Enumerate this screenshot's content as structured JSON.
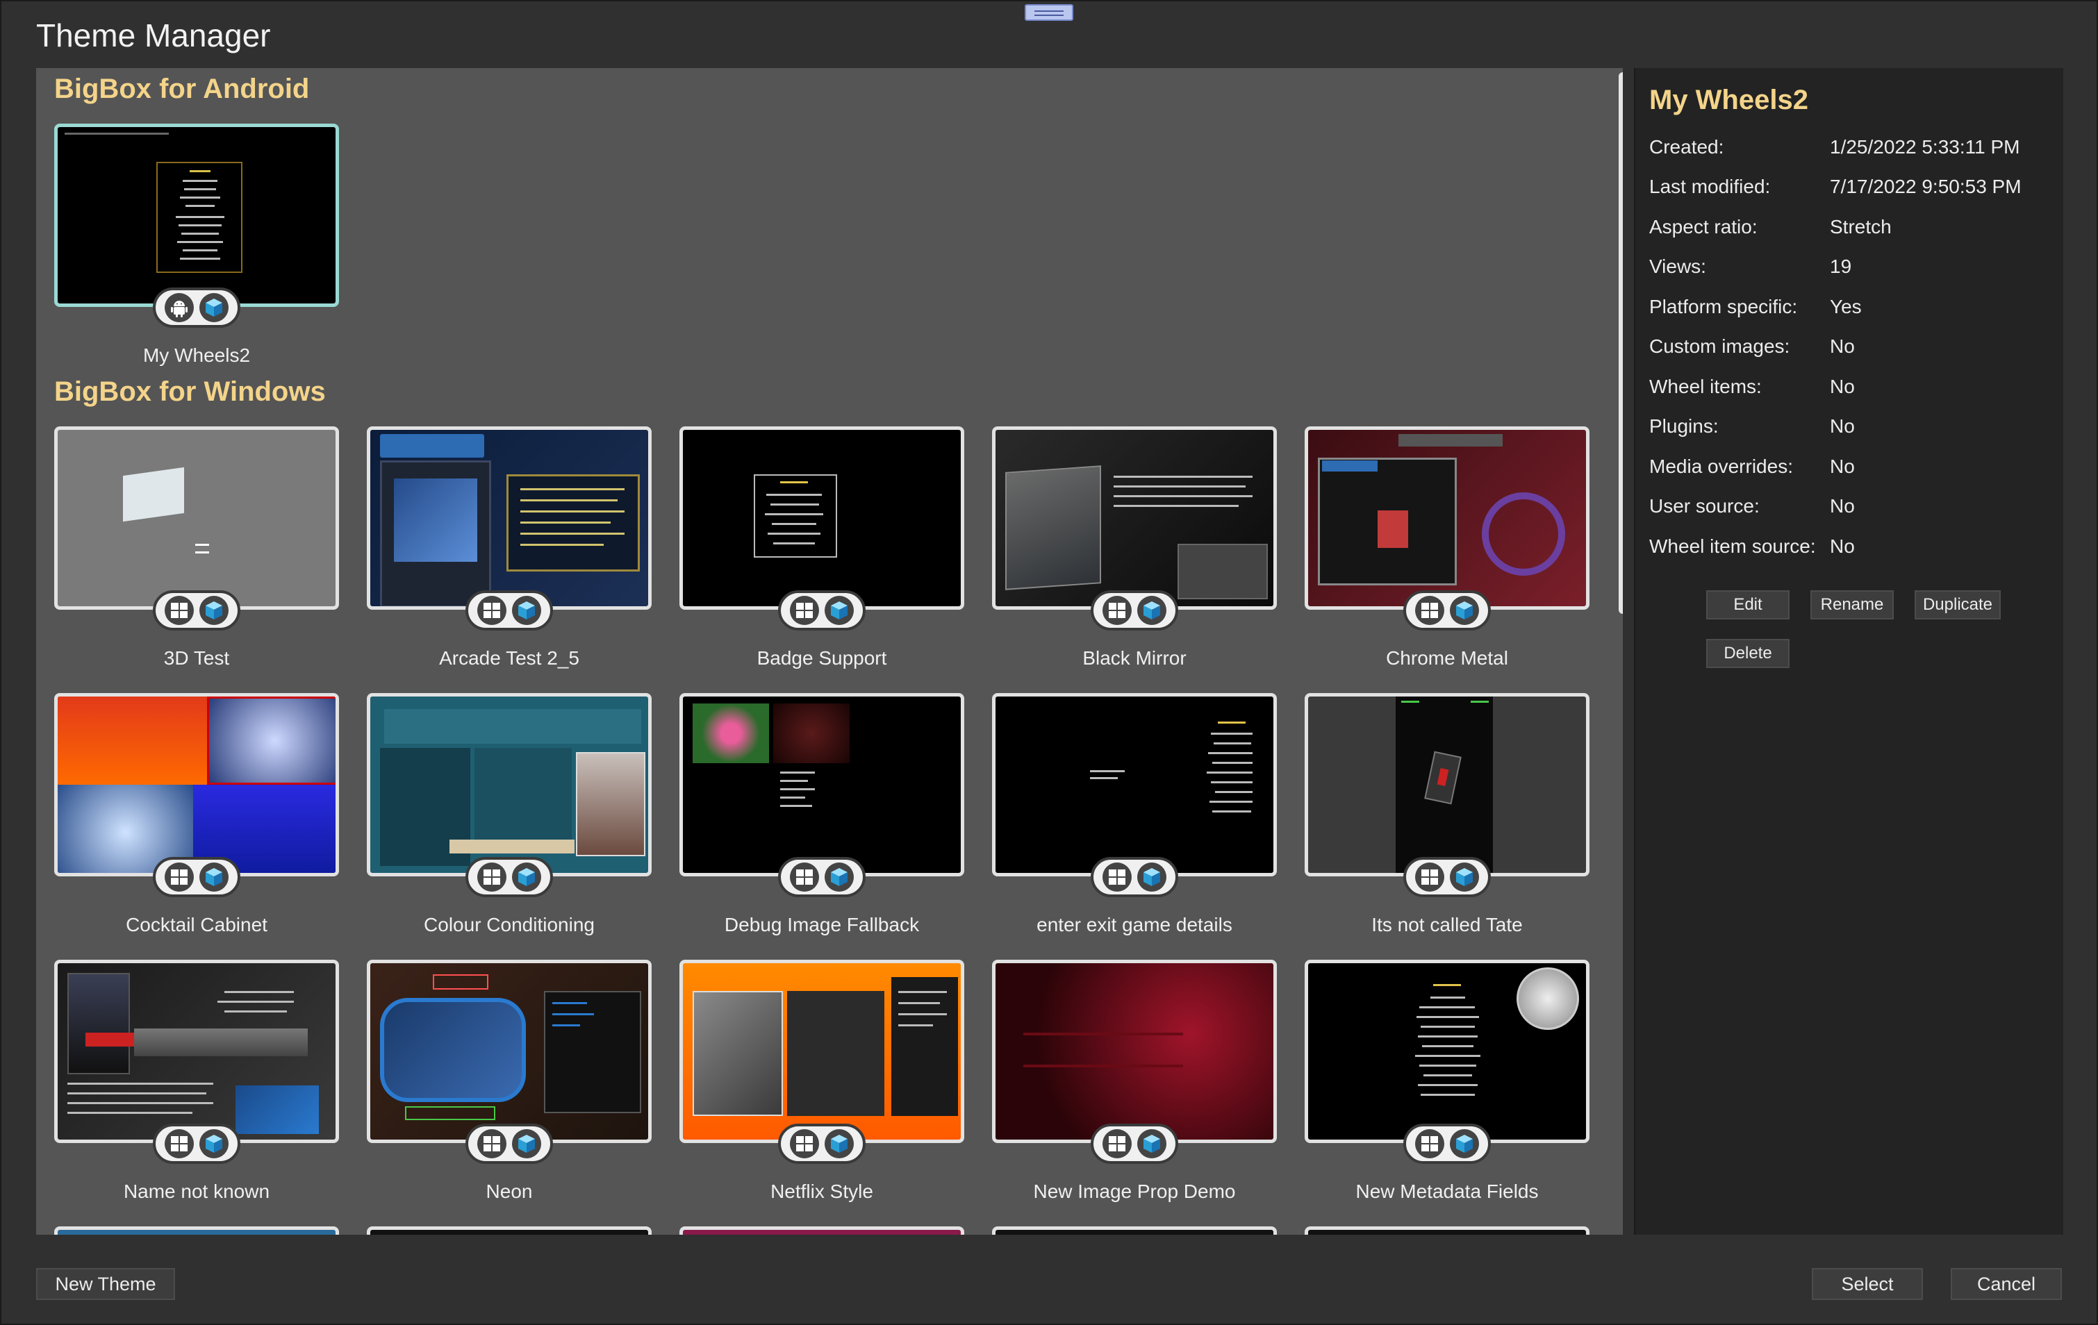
{
  "window": {
    "title": "Theme Manager"
  },
  "sections": [
    {
      "title": "BigBox for Android",
      "themes": [
        {
          "name": "My Wheels2",
          "platform": "android"
        }
      ]
    },
    {
      "title": "BigBox for Windows",
      "themes": [
        {
          "name": "3D Test",
          "platform": "windows"
        },
        {
          "name": "Arcade Test 2_5",
          "platform": "windows"
        },
        {
          "name": "Badge Support",
          "platform": "windows"
        },
        {
          "name": "Black Mirror",
          "platform": "windows"
        },
        {
          "name": "Chrome Metal",
          "platform": "windows"
        },
        {
          "name": "Cocktail Cabinet",
          "platform": "windows"
        },
        {
          "name": "Colour Conditioning",
          "platform": "windows"
        },
        {
          "name": "Debug Image Fallback",
          "platform": "windows"
        },
        {
          "name": "enter exit game details",
          "platform": "windows"
        },
        {
          "name": "Its not called Tate",
          "platform": "windows"
        },
        {
          "name": "Name not known",
          "platform": "windows"
        },
        {
          "name": "Neon",
          "platform": "windows"
        },
        {
          "name": "Netflix Style",
          "platform": "windows"
        },
        {
          "name": "New Image Prop Demo",
          "platform": "windows"
        },
        {
          "name": "New Metadata Fields",
          "platform": "windows"
        }
      ]
    }
  ],
  "details": {
    "title": "My Wheels2",
    "rows": [
      {
        "label": "Created:",
        "value": "1/25/2022 5:33:11 PM"
      },
      {
        "label": "Last modified:",
        "value": "7/17/2022 9:50:53 PM"
      },
      {
        "label": "Aspect ratio:",
        "value": "Stretch"
      },
      {
        "label": "Views:",
        "value": "19"
      },
      {
        "label": "Platform specific:",
        "value": "Yes"
      },
      {
        "label": "Custom images:",
        "value": "No"
      },
      {
        "label": "Wheel items:",
        "value": "No"
      },
      {
        "label": "Plugins:",
        "value": "No"
      },
      {
        "label": "Media overrides:",
        "value": "No"
      },
      {
        "label": "User source:",
        "value": "No"
      },
      {
        "label": "Wheel item source:",
        "value": "No"
      }
    ],
    "buttons": {
      "edit": "Edit",
      "rename": "Rename",
      "duplicate": "Duplicate",
      "delete": "Delete"
    }
  },
  "footer": {
    "new_theme": "New Theme",
    "select": "Select",
    "cancel": "Cancel"
  },
  "icons": {
    "android": "android-icon",
    "windows": "windows-icon",
    "bigbox": "bigbox-cube-icon"
  }
}
